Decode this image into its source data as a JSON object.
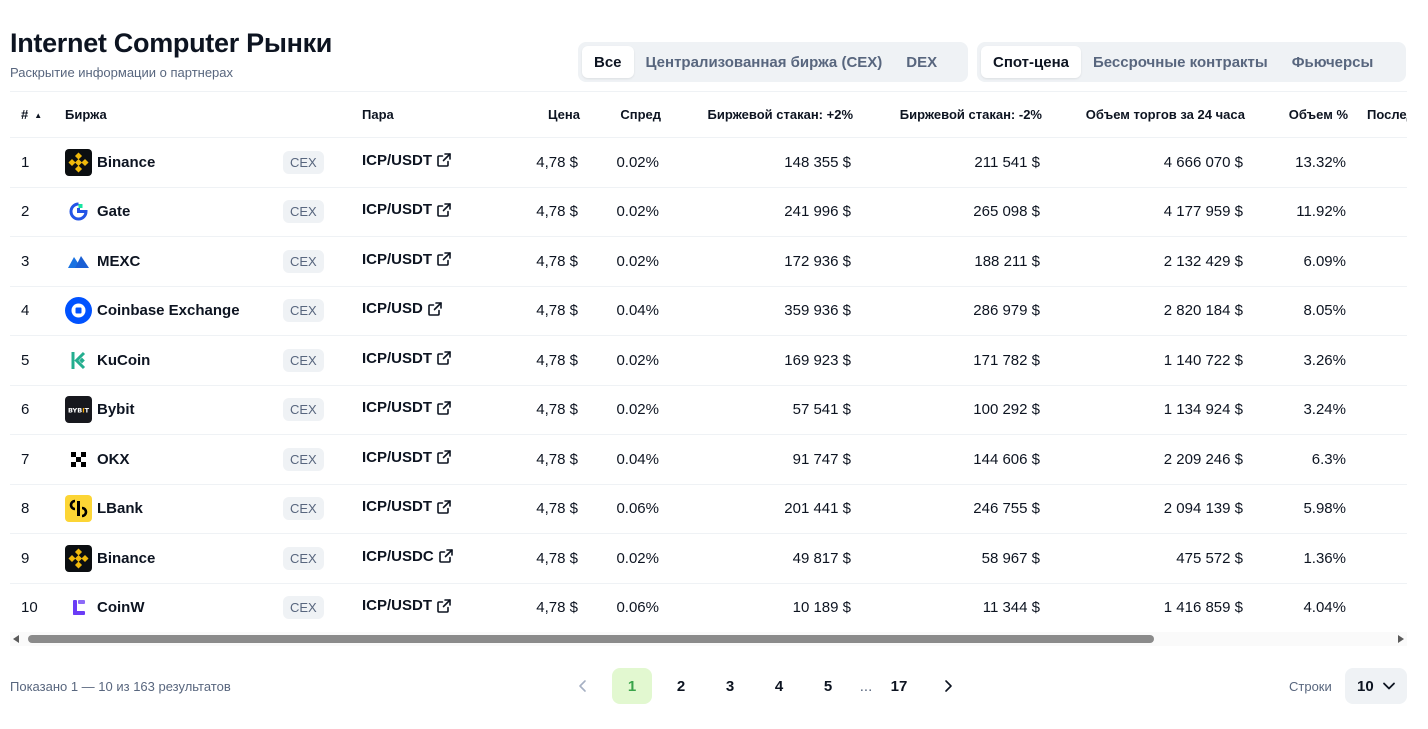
{
  "header": {
    "title": "Internet Computer Рынки",
    "subtitle": "Раскрытие информации о партнерах"
  },
  "filters": {
    "exchange_type": [
      "Все",
      "Централизованная биржа (CEX)",
      "DEX"
    ],
    "market_type": [
      "Спот-цена",
      "Бессрочные контракты",
      "Фьючерсы"
    ]
  },
  "table": {
    "columns": {
      "rank": "#",
      "exchange": "Биржа",
      "pair": "Пара",
      "price": "Цена",
      "spread": "Спред",
      "depth_plus": "Биржевой стакан: +2%",
      "depth_minus": "Биржевой стакан: -2%",
      "volume": "Объем торгов за 24 часа",
      "volume_pct": "Объем %",
      "last_updated": "Последнее об"
    },
    "rows": [
      {
        "rank": "1",
        "exchange": "Binance",
        "logo": "binance-logo",
        "type": "CEX",
        "pair": "ICP/USDT",
        "price": "4,78 $",
        "spread": "0.02%",
        "depth_plus": "148 355 $",
        "depth_minus": "211 541 $",
        "volume": "4 666 070 $",
        "volume_pct": "13.32%"
      },
      {
        "rank": "2",
        "exchange": "Gate",
        "logo": "gate-logo",
        "type": "CEX",
        "pair": "ICP/USDT",
        "price": "4,78 $",
        "spread": "0.02%",
        "depth_plus": "241 996 $",
        "depth_minus": "265 098 $",
        "volume": "4 177 959 $",
        "volume_pct": "11.92%"
      },
      {
        "rank": "3",
        "exchange": "MEXC",
        "logo": "mexc-logo",
        "type": "CEX",
        "pair": "ICP/USDT",
        "price": "4,78 $",
        "spread": "0.02%",
        "depth_plus": "172 936 $",
        "depth_minus": "188 211 $",
        "volume": "2 132 429 $",
        "volume_pct": "6.09%"
      },
      {
        "rank": "4",
        "exchange": "Coinbase Exchange",
        "logo": "coinbase-logo",
        "type": "CEX",
        "pair": "ICP/USD",
        "price": "4,78 $",
        "spread": "0.04%",
        "depth_plus": "359 936 $",
        "depth_minus": "286 979 $",
        "volume": "2 820 184 $",
        "volume_pct": "8.05%"
      },
      {
        "rank": "5",
        "exchange": "KuCoin",
        "logo": "kucoin-logo",
        "type": "CEX",
        "pair": "ICP/USDT",
        "price": "4,78 $",
        "spread": "0.02%",
        "depth_plus": "169 923 $",
        "depth_minus": "171 782 $",
        "volume": "1 140 722 $",
        "volume_pct": "3.26%"
      },
      {
        "rank": "6",
        "exchange": "Bybit",
        "logo": "bybit-logo",
        "type": "CEX",
        "pair": "ICP/USDT",
        "price": "4,78 $",
        "spread": "0.02%",
        "depth_plus": "57 541 $",
        "depth_minus": "100 292 $",
        "volume": "1 134 924 $",
        "volume_pct": "3.24%"
      },
      {
        "rank": "7",
        "exchange": "OKX",
        "logo": "okx-logo",
        "type": "CEX",
        "pair": "ICP/USDT",
        "price": "4,78 $",
        "spread": "0.04%",
        "depth_plus": "91 747 $",
        "depth_minus": "144 606 $",
        "volume": "2 209 246 $",
        "volume_pct": "6.3%"
      },
      {
        "rank": "8",
        "exchange": "LBank",
        "logo": "lbank-logo",
        "type": "CEX",
        "pair": "ICP/USDT",
        "price": "4,78 $",
        "spread": "0.06%",
        "depth_plus": "201 441 $",
        "depth_minus": "246 755 $",
        "volume": "2 094 139 $",
        "volume_pct": "5.98%"
      },
      {
        "rank": "9",
        "exchange": "Binance",
        "logo": "binance-logo",
        "type": "CEX",
        "pair": "ICP/USDC",
        "price": "4,78 $",
        "spread": "0.02%",
        "depth_plus": "49 817 $",
        "depth_minus": "58 967 $",
        "volume": "475 572 $",
        "volume_pct": "1.36%"
      },
      {
        "rank": "10",
        "exchange": "CoinW",
        "logo": "coinw-logo",
        "type": "CEX",
        "pair": "ICP/USDT",
        "price": "4,78 $",
        "spread": "0.06%",
        "depth_plus": "10 189 $",
        "depth_minus": "11 344 $",
        "volume": "1 416 859 $",
        "volume_pct": "4.04%"
      }
    ]
  },
  "footer": {
    "shown_text": "Показано 1 — 10 из 163 результатов",
    "pages": [
      "1",
      "2",
      "3",
      "4",
      "5",
      "...",
      "17"
    ],
    "active_page": "1",
    "rows_label": "Строки",
    "rows_value": "10"
  },
  "colors": {
    "accent_active_page_bg": "#e2f8d0",
    "accent_active_page_text": "#3aa44a",
    "text_primary": "#0d1421",
    "text_secondary": "#58667e",
    "segment_bg": "#eff2f5"
  }
}
